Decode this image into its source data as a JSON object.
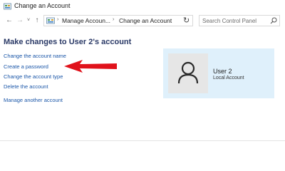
{
  "window": {
    "title": "Change an Account"
  },
  "navigation": {
    "back": "←",
    "forward": "→",
    "history": "˅",
    "up": "↑",
    "breadcrumbs": [
      "Manage Accoun...",
      "Change an Account"
    ],
    "separator": "›",
    "dropdown": "˅",
    "refresh": "↻",
    "search_placeholder": "Search Control Panel"
  },
  "main": {
    "heading": "Make changes to User 2's account",
    "links": [
      "Change the account name",
      "Create a password",
      "Change the account type",
      "Delete the account",
      "Manage another account"
    ]
  },
  "account": {
    "name": "User 2",
    "type": "Local Account"
  },
  "colors": {
    "link": "#1a56a8",
    "heading": "#2b3a67",
    "panel_bg": "#dff0fb",
    "annotation_arrow": "#e0121b"
  },
  "icons": [
    "control-panel-icon",
    "user-avatar-icon",
    "search-icon"
  ]
}
